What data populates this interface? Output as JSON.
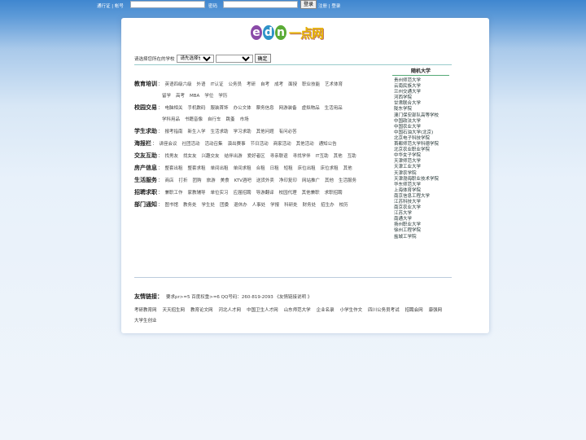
{
  "topbar": {
    "account_label": "通行证 | 帐号",
    "password_label": "密码",
    "login_button": "登录",
    "register_label": "注册 | 登录"
  },
  "logo": {
    "letters": [
      "e",
      "d",
      "n"
    ],
    "text": "一点网",
    "colors": [
      "#8a4aa8",
      "#2e92c8",
      "#5aab36"
    ]
  },
  "school_selector": {
    "label": "请选择您所在的学校",
    "province_value": "请先选择省份",
    "school_value": "",
    "confirm_button": "确定"
  },
  "categories": [
    {
      "title": "教育培训",
      "items": [
        "英语四级六级",
        "外语",
        "IT认证",
        "公务员",
        "考研",
        "自考",
        "成考",
        "面授",
        "职业技能",
        "艺术体育"
      ]
    },
    {
      "title": "",
      "items": [
        "留学",
        "高考",
        "MBA",
        "学位",
        "学历"
      ]
    },
    {
      "title": "校园交易",
      "items": [
        "电脑相关",
        "手机数码",
        "服装首饰",
        "办公文体",
        "票务信息",
        "网游装备",
        "虚拟物品",
        "生活用品"
      ]
    },
    {
      "title": "",
      "items": [
        "学科用品",
        "书籍音像",
        "自行车",
        "跳蚤",
        "市场"
      ]
    },
    {
      "title": "学生求助",
      "items": [
        "报考指南",
        "新生入学",
        "生活求助",
        "学习求助",
        "其他问题",
        "有问必答"
      ]
    },
    {
      "title": "海报栏",
      "items": [
        "讲座会议",
        "社团活动",
        "活动召集",
        "演出赛事",
        "节日活动",
        "商家活动",
        "其他活动",
        "通知公告"
      ]
    },
    {
      "title": "交友互助",
      "items": [
        "找男友",
        "找女友",
        "兴趣交友",
        "结伴出游",
        "爱好者区",
        "寻亲联谊",
        "寻找学伴",
        "IT互助",
        "其他",
        "互助"
      ]
    },
    {
      "title": "房产信息",
      "items": [
        "整套出租",
        "整套求租",
        "单间出租",
        "单间求租",
        "合租",
        "日租",
        "短租",
        "床位出租",
        "床位求租",
        "其他"
      ]
    },
    {
      "title": "生活服务",
      "items": [
        "商店",
        "打折",
        "团购",
        "旅游",
        "美食",
        "KTV酒吧",
        "送货外卖",
        "净印复印",
        "网站推广",
        "其他",
        "生活服务"
      ]
    },
    {
      "title": "招聘求职",
      "items": [
        "兼职工作",
        "家教辅导",
        "单位实习",
        "应届招聘",
        "导游翻译",
        "校园代理",
        "其他兼职",
        "求职招聘"
      ]
    },
    {
      "title": "部门通知",
      "items": [
        "图书馆",
        "教务处",
        "学生处",
        "团委",
        "退休办",
        "人事处",
        "学报",
        "科研处",
        "财务处",
        "招生办",
        "校历"
      ]
    }
  ],
  "random_univ": {
    "title": "随机大学",
    "items": [
      "贵州师范大学",
      "云南民族大学",
      "兰州交通大学",
      "河西学院",
      "甘肃联合大学",
      "陇东学院",
      "澳门保安部队高等学校",
      "中国政法大学",
      "中国农业大学",
      "中国石油大学(北京)",
      "北京电子科技学院",
      "首都师范大学科德学院",
      "北京农业职业学院",
      "中华女子学院",
      "天津师范大学",
      "天津工业大学",
      "天津农学院",
      "天津渤海职业技术学院",
      "华东师范大学",
      "上海体育学院",
      "南京信息工程大学",
      "江苏科技大学",
      "南京农业大学",
      "江苏大学",
      "南通大学",
      "扬州职业大学",
      "徐州工程学院",
      "盐城工学院"
    ]
  },
  "friend_links": {
    "title": "友情链接：",
    "note": "要求pr>=5 百度权重>=6 QQ号码：260-819-2093 《友情链接说明 》",
    "links": [
      "考研教育网",
      "天天招生网",
      "教育论文网",
      "河北人才网",
      "中国卫生人才网",
      "山东师范大学",
      "企业名录",
      "小学生作文",
      "四川公务员考试",
      "招聘会网",
      "康强网",
      "大学生创业"
    ]
  }
}
